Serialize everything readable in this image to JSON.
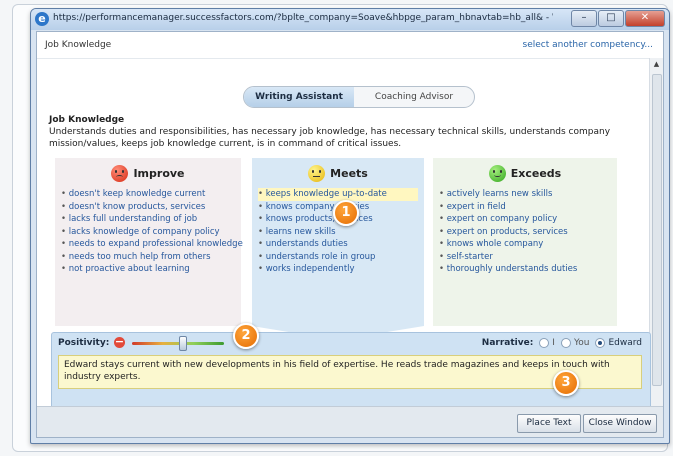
{
  "browser": {
    "title": "https://performancemanager.successfactors.com/?bplte_company=Soave&hbpge_param_hbnavtab=hb_all&  - Windows Internet Explorer"
  },
  "header": {
    "competency": "Job Knowledge",
    "select_link": "select another competency..."
  },
  "tabs": [
    {
      "label": "Writing Assistant",
      "active": true
    },
    {
      "label": "Coaching Advisor",
      "active": false
    }
  ],
  "intro": {
    "title": "Job Knowledge",
    "description": "Understands duties and responsibilities, has necessary job knowledge, has necessary technical skills, understands company mission/values, keeps job knowledge current, is in command of critical issues."
  },
  "columns": {
    "improve": {
      "label": "Improve",
      "icon": "sad-face-icon",
      "color": "#d62a12",
      "items": [
        "doesn't keep knowledge current",
        "doesn't know products, services",
        "lacks full understanding of job",
        "lacks knowledge of company policy",
        "needs to expand professional knowledge",
        "needs too much help from others",
        "not proactive about learning"
      ]
    },
    "meets": {
      "label": "Meets",
      "icon": "neutral-face-icon",
      "color": "#e5b40a",
      "items": [
        "keeps knowledge up-to-date",
        "knows company policies",
        "knows products, services",
        "learns new skills",
        "understands duties",
        "understands role in group",
        "works independently"
      ]
    },
    "exceeds": {
      "label": "Exceeds",
      "icon": "happy-face-icon",
      "color": "#33a51f",
      "items": [
        "actively learns new skills",
        "expert in field",
        "expert on company policy",
        "expert on products, services",
        "knows whole company",
        "self-starter",
        "thoroughly understands duties"
      ]
    }
  },
  "positivity": {
    "label": "Positivity:",
    "slider_value": 0.55,
    "narrative_label": "Narrative:",
    "options": [
      "I",
      "You",
      "Edward"
    ],
    "selected": "Edward",
    "text": "Edward stays current with new developments in his field of expertise. He reads trade magazines and keeps in touch with industry experts."
  },
  "buttons": {
    "place_text": "Place Text",
    "close_window": "Close Window"
  },
  "callouts": [
    "1",
    "2",
    "3"
  ],
  "colors": {
    "accent": "#2a65a8",
    "callout": "#e46b00"
  }
}
